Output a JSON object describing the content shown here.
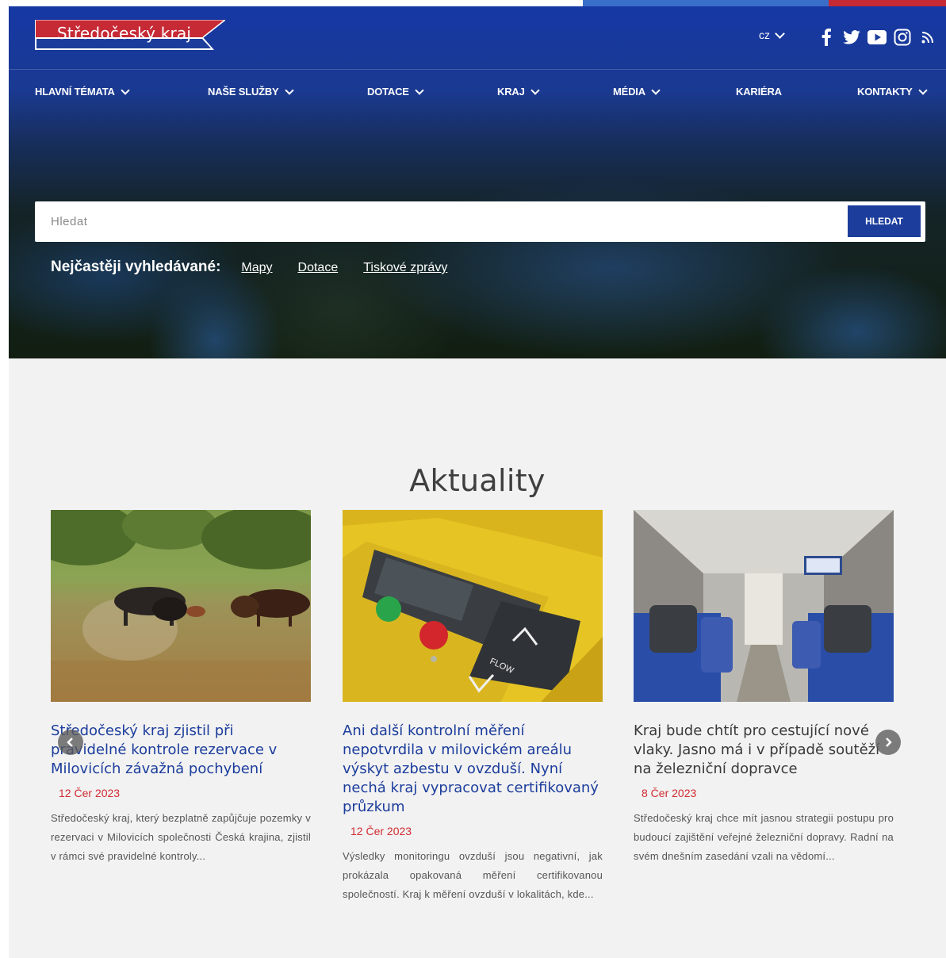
{
  "header": {
    "logo_text": "Středočeský kraj",
    "language": "cz",
    "social_icons": [
      "facebook-icon",
      "twitter-icon",
      "youtube-icon",
      "instagram-icon",
      "rss-icon"
    ]
  },
  "nav": {
    "items": [
      {
        "label": "HLAVNÍ TÉMATA",
        "dropdown": true
      },
      {
        "label": "NAŠE SLUŽBY",
        "dropdown": true
      },
      {
        "label": "DOTACE",
        "dropdown": true
      },
      {
        "label": "KRAJ",
        "dropdown": true
      },
      {
        "label": "MÉDIA",
        "dropdown": true
      },
      {
        "label": "KARIÉRA",
        "dropdown": false
      },
      {
        "label": "KONTAKTY",
        "dropdown": true
      }
    ]
  },
  "search": {
    "placeholder": "Hledat",
    "button_label": "HLEDAT"
  },
  "popular": {
    "label": "Nejčastěji vyhledávané:",
    "links": [
      "Mapy",
      "Dotace",
      "Tiskové zprávy"
    ]
  },
  "news": {
    "title": "Aktuality",
    "articles": [
      {
        "title": "Středočeský kraj zjistil při pravidelné kontrole rezervace v Milovicích závažná pochybení",
        "date": "12 Čer 2023",
        "text": "Středočeský kraj, který bezplatně zapůjčuje pozemky v rezervaci v Milovicích společnosti Česká krajina, zjistil v rámci své pravidelné kontroly..."
      },
      {
        "title": "Ani další kontrolní měření nepotvrdila v milovickém areálu výskyt azbestu v ovzduší. Nyní nechá kraj vypracovat certifikovaný průzkum",
        "date": "12 Čer 2023",
        "text": "Výsledky monitoringu ovzduší jsou negativní, jak prokázala opakovaná měření certifikovanou společností. Kraj k měření ovzduší v lokalitách, kde..."
      },
      {
        "title": "Kraj bude chtít pro cestující nové vlaky. Jasno má i v případě soutěží na železniční dopravce",
        "date": "8 Čer 2023",
        "text": "Středočeský kraj chce mít jasnou strategii postupu pro budoucí zajištění veřejné železniční dopravy. Radní na svém dnešním zasedání vzali na vědomí..."
      }
    ]
  },
  "colors": {
    "header_blue": "#1c3d9c",
    "accent_red": "#d12b31",
    "link_blue": "#1c3d9c"
  }
}
